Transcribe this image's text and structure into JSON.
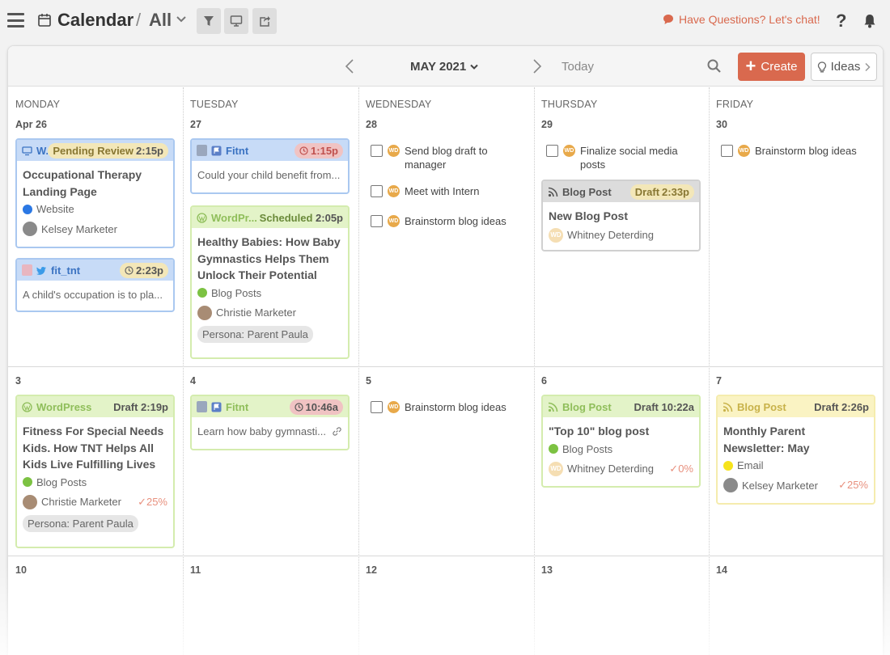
{
  "header": {
    "app_title": "Calendar",
    "separator": "/",
    "view_title": "All",
    "chat_link": "Have Questions? Let's chat!",
    "help": "?"
  },
  "toolbar": {
    "month": "MAY 2021",
    "today": "Today",
    "create": "Create",
    "ideas": "Ideas"
  },
  "days": [
    "MONDAY",
    "TUESDAY",
    "WEDNESDAY",
    "THURSDAY",
    "FRIDAY"
  ],
  "week_dates": [
    [
      "Apr 26",
      "27",
      "28",
      "29",
      "30"
    ],
    [
      "3",
      "4",
      "5",
      "6",
      "7"
    ],
    [
      "10",
      "11",
      "12",
      "13",
      "14"
    ]
  ],
  "cards": {
    "ot": {
      "source": "W...",
      "status": "Pending Review",
      "time": "2:15p",
      "title": "Occupational Therapy Landing Page",
      "category": "Website",
      "category_color": "#2b78e4",
      "owner": "Kelsey Marketer"
    },
    "tw": {
      "source": "fit_tnt",
      "time": "2:23p",
      "preview": "A child's occupation is to pla..."
    },
    "fb1": {
      "source": "Fitnt",
      "time": "1:15p",
      "preview": "Could your child benefit from..."
    },
    "hb": {
      "source": "WordPr...",
      "status": "Scheduled",
      "time": "2:05p",
      "title": "Healthy Babies: How Baby Gymnastics Helps Them Unlock Their Potential",
      "category": "Blog Posts",
      "category_color": "#7cc242",
      "owner": "Christie Marketer",
      "tag": "Persona: Parent Paula"
    },
    "bp1": {
      "source": "Blog Post",
      "status": "Draft",
      "time": "2:33p",
      "title": "New Blog Post",
      "owner": "Whitney Deterding"
    },
    "fs": {
      "source": "WordPress",
      "status": "Draft",
      "time": "2:19p",
      "title": "Fitness For Special Needs Kids. How TNT Helps All Kids Live Fulfilling Lives",
      "category": "Blog Posts",
      "category_color": "#7cc242",
      "owner": "Christie Marketer",
      "progress": "25%",
      "tag": "Persona: Parent Paula"
    },
    "fb2": {
      "source": "Fitnt",
      "time": "10:46a",
      "preview": "Learn how baby gymnasti..."
    },
    "top10": {
      "source": "Blog Post",
      "status": "Draft",
      "time": "10:22a",
      "title": "\"Top 10\" blog post",
      "category": "Blog Posts",
      "category_color": "#7cc242",
      "owner": "Whitney Deterding",
      "progress": "0%"
    },
    "news": {
      "source": "Blog Post",
      "status": "Draft",
      "time": "2:26p",
      "title": "Monthly Parent Newsletter: May",
      "category": "Email",
      "category_color": "#f6e31c",
      "owner": "Kelsey Marketer",
      "progress": "25%"
    }
  },
  "tasks": {
    "wed1": "Send blog draft to manager",
    "wed2": "Meet with Intern",
    "wed3": "Brainstorm blog ideas",
    "thu1": "Finalize social media posts",
    "fri1": "Brainstorm blog ideas",
    "wed_w2": "Brainstorm blog ideas",
    "initials": "WD"
  },
  "colors": {
    "accent": "#d9694e",
    "website_blue": "#2b78e4",
    "blog_green": "#7cc242",
    "email_yellow": "#f6e31c"
  }
}
